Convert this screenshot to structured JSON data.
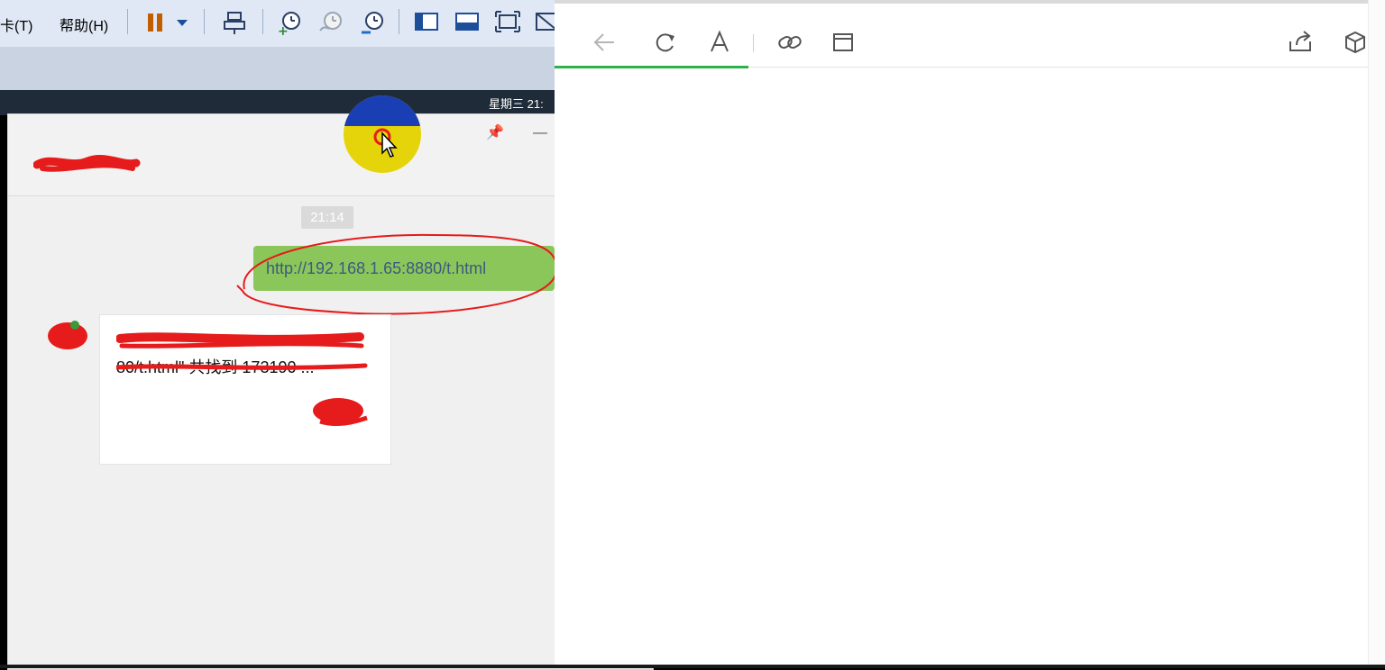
{
  "vm_window": {
    "menu": [
      {
        "label": "卡(T)"
      },
      {
        "label": "帮助(H)"
      }
    ],
    "toolbar_icons": [
      "pause-icon",
      "dropdown-arrow-icon",
      "send-ctrl-alt-del-icon",
      "snapshot-icon",
      "revert-snapshot-icon",
      "snapshot-manager-icon",
      "unity-view-icon",
      "console-view-icon",
      "fullscreen-icon",
      "no-fullscreen-icon"
    ],
    "accent_pause": "#c25e00"
  },
  "guest": {
    "clock_text": "星期三 21:"
  },
  "chat": {
    "timestamp": "21:14",
    "sent_message": "http://192.168.1.65:8880/t.html",
    "received_card_text": "80/t.html\" 共找到 173190 ...",
    "window_buttons": {
      "pin": "📌",
      "minimize": "—",
      "maximize": "☐",
      "close": "✕"
    },
    "more_label": "···",
    "bubble_color": "#8bc65a",
    "annotation_color": "#e61b1b"
  },
  "browser": {
    "toolbar_icons": [
      "back-arrow-icon",
      "refresh-icon",
      "reader-font-icon",
      "link-icon",
      "window-icon",
      "share-icon",
      "cube-icon"
    ],
    "load_color": "#2db24a"
  }
}
